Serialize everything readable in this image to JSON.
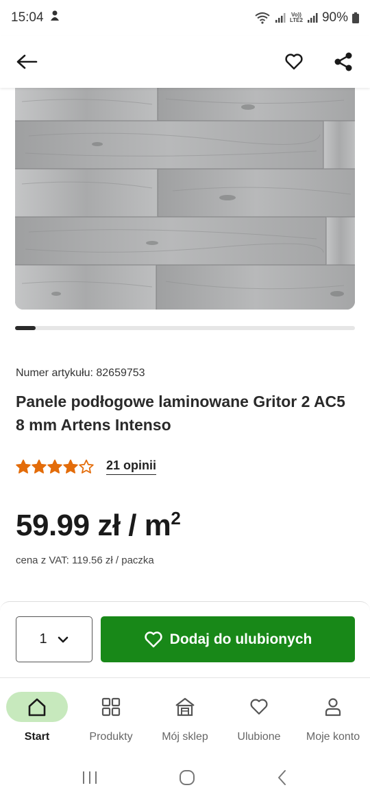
{
  "status_bar": {
    "time": "15:04",
    "battery": "90%",
    "network_label": "VoLTE2"
  },
  "header": {
    "back_icon": "arrow-left-icon",
    "favorite_icon": "heart-outline-icon",
    "share_icon": "share-icon"
  },
  "gallery": {
    "image_description_icon": "wood-floor-image",
    "progress": 0.06
  },
  "product": {
    "article_number": "Numer artykułu: 82659753",
    "title": "Panele podłogowe laminowane Gritor 2 AC5 8 mm Artens Intenso",
    "rating": 4,
    "rating_max": 5,
    "reviews": "21 opinii",
    "price_main": "59.99 zł / m",
    "price_sup": "2",
    "price_vat": "cena z VAT: 119.56 zł / paczka",
    "star_color": "#e36c0a"
  },
  "actions": {
    "quantity": "1",
    "add_to_favorites": "Dodaj do ulubionych",
    "accent_color": "#188818"
  },
  "bottom_nav": {
    "items": [
      {
        "label": "Start",
        "icon": "home-icon",
        "active": true
      },
      {
        "label": "Produkty",
        "icon": "grid-icon",
        "active": false
      },
      {
        "label": "Mój sklep",
        "icon": "store-icon",
        "active": false
      },
      {
        "label": "Ulubione",
        "icon": "heart-icon",
        "active": false
      },
      {
        "label": "Moje konto",
        "icon": "user-icon",
        "active": false
      }
    ]
  }
}
